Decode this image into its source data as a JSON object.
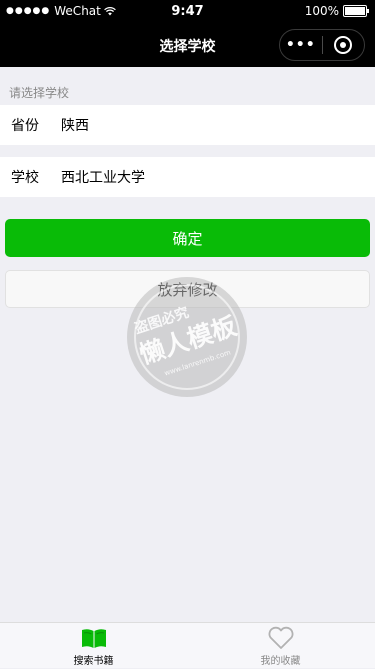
{
  "status_bar": {
    "signal": "●●●●●",
    "carrier": "WeChat",
    "time": "9:47",
    "battery": "100%"
  },
  "nav": {
    "title": "选择学校",
    "more_label": "•••"
  },
  "form": {
    "hint": "请选择学校",
    "province_label": "省份",
    "province_value": "陕西",
    "school_label": "学校",
    "school_value": "西北工业大学"
  },
  "buttons": {
    "confirm": "确定",
    "discard": "放弃修改"
  },
  "watermark": {
    "top": "盗图必究",
    "main": "懒人模板",
    "url": "www.lanrenmb.com"
  },
  "tabbar": {
    "tabs": [
      {
        "label": "搜索书籍",
        "icon": "book-icon",
        "active": true
      },
      {
        "label": "我的收藏",
        "icon": "heart-icon",
        "active": false
      }
    ]
  },
  "colors": {
    "primary": "#09bb07",
    "nav_bg": "#000000",
    "page_bg": "#efeff4"
  }
}
